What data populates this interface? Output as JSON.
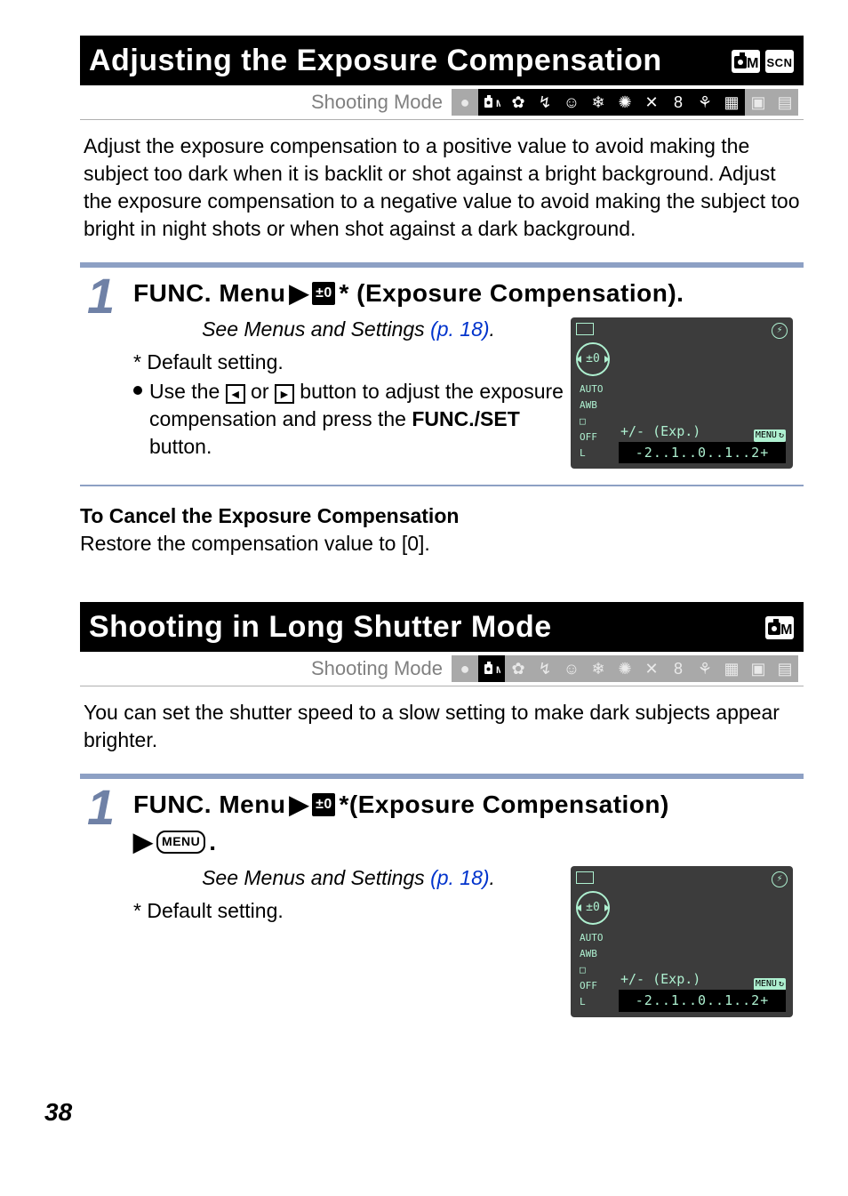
{
  "section1": {
    "title": "Adjusting the Exposure Compensation",
    "shootingLabel": "Shooting Mode",
    "body": "Adjust the exposure compensation to a positive value to avoid making the subject too dark when it is backlit or shot against a bright background. Adjust the exposure compensation to a negative value to avoid making the subject too bright in night shots or when shot against a dark background.",
    "step": {
      "num": "1",
      "title_a": "FUNC. Menu",
      "title_b": "* (Exposure Compensation).",
      "seePrefix": "See Menus and Settings ",
      "seeLink": "(p. 18)",
      "seeSuffix": ".",
      "default": "* Default setting.",
      "bullet_a": "Use the ",
      "bullet_b": " or ",
      "bullet_c": " button to adjust the exposure compensation and press the ",
      "bullet_bold": "FUNC./SET",
      "bullet_d": " button."
    },
    "cancelTitle": "To Cancel the Exposure Compensation",
    "cancelBody": "Restore the compensation value to [0]."
  },
  "section2": {
    "title": "Shooting in Long Shutter Mode",
    "shootingLabel": "Shooting Mode",
    "body": "You can set the shutter speed to a slow setting to make dark subjects appear brighter.",
    "step": {
      "num": "1",
      "title_a": "FUNC. Menu",
      "title_b": "*(Exposure Compensation)",
      "title_end": ".",
      "seePrefix": "See Menus and Settings ",
      "seeLink": "(p. 18)",
      "seeSuffix": ".",
      "default": "* Default setting."
    }
  },
  "shot": {
    "dial": "±0",
    "col1": "AUTO",
    "col2": "AWB",
    "col3": "□",
    "col4": "OFF",
    "col5": "L",
    "label": "+/- (Exp.)",
    "menu": "MENU",
    "scale": "-2..1..0..1..2+",
    "flash": "⚡"
  },
  "modes": {
    "s1": [
      "●",
      "M",
      "✿",
      "↯",
      "A",
      "☃",
      "✺",
      "✕",
      "8",
      "⚘",
      "▦",
      "▣",
      "▤"
    ],
    "s1on": [
      false,
      true,
      true,
      true,
      true,
      true,
      true,
      true,
      true,
      true,
      true,
      false,
      false
    ],
    "s2on": [
      false,
      true,
      false,
      false,
      false,
      false,
      false,
      false,
      false,
      false,
      false,
      false,
      false
    ]
  },
  "headerIcons": {
    "om": "◙M",
    "scn": "SCN"
  },
  "pageNum": "38"
}
